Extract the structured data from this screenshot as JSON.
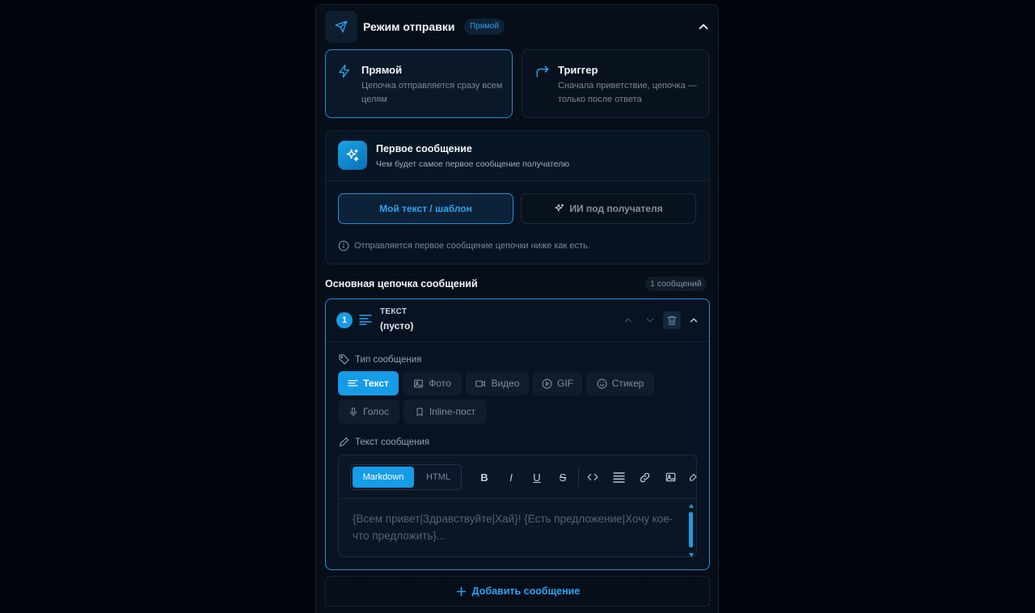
{
  "header": {
    "title": "Режим отправки",
    "badge": "Прямой",
    "icon": "send-icon"
  },
  "modes": [
    {
      "title": "Прямой",
      "desc": "Цепочка отправляется сразу всем целям",
      "icon": "bolt-icon",
      "active": true
    },
    {
      "title": "Триггер",
      "desc": "Сначала приветствие, цепочка — только после ответа",
      "icon": "redirect-arrow-icon",
      "active": false
    }
  ],
  "first_message": {
    "title": "Первое сообщение",
    "subtitle": "Чем будет самое первое сообщение получателю",
    "options": [
      "Мой текст / шаблон",
      "ИИ под получателя"
    ],
    "selected": "Мой текст / шаблон",
    "info": "Отправляется первое сообщение цепочки ниже как есть."
  },
  "chain": {
    "title": "Основная цепочка сообщений",
    "count": "1 сообщений"
  },
  "message": {
    "number": "1",
    "type_label": "ТЕКСТ",
    "preview": "(пусто)",
    "type_section": "Тип сообщения",
    "types": [
      {
        "label": "Текст",
        "icon": "lines-icon",
        "active": true
      },
      {
        "label": "Фото",
        "icon": "image-icon",
        "active": false
      },
      {
        "label": "Видео",
        "icon": "video-icon",
        "active": false
      },
      {
        "label": "GIF",
        "icon": "play-circle-icon",
        "active": false
      },
      {
        "label": "Стикер",
        "icon": "smile-icon",
        "active": false
      },
      {
        "label": "Голос",
        "icon": "microphone-icon",
        "active": false
      },
      {
        "label": "Inline-пост",
        "icon": "bookmark-icon",
        "active": false
      }
    ],
    "text_section": "Текст сообщения",
    "editor": {
      "modes": [
        "Markdown",
        "HTML"
      ],
      "selected_mode": "Markdown",
      "toolbar": [
        "B",
        "I",
        "U",
        "S"
      ],
      "placeholder": "{Всем привет|Здравствуйте|Хай}! {Есть предложение|Хочу кое-что предложить}..."
    }
  },
  "add_button": "Добавить сообщение",
  "colors": {
    "accent": "#1a9be3",
    "background": "#02060c",
    "panel": "#060e19"
  }
}
